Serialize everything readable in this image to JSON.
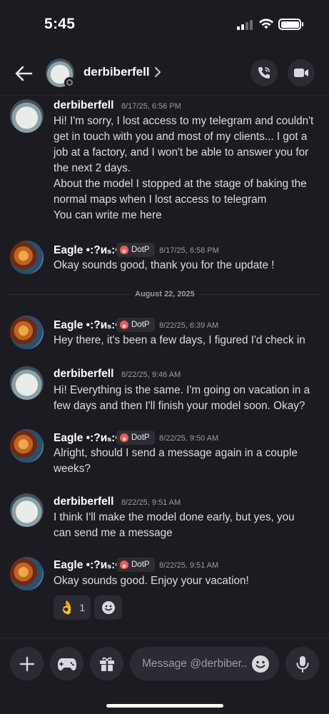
{
  "status_bar": {
    "time": "5:45"
  },
  "header": {
    "title": "derbiberfell"
  },
  "divider": {
    "label": "August 22, 2025"
  },
  "messages": [
    {
      "author": "derbiberfell",
      "timestamp": "8/17/25, 6:56 PM",
      "lines": [
        "Hi! I'm sorry, I lost access to my telegram and couldn't",
        "get in touch with you and most of my clients... I got a",
        "job at a factory, and I won't be able to answer you for",
        "the next 2 days.",
        "About the model I stopped at the stage of baking the",
        "normal maps when I lost access to telegram"
      ],
      "extra": "You can write me here"
    },
    {
      "author": "Eagle •:?ᴎₛ:•",
      "badge": "DotP",
      "timestamp": "8/17/25, 6:58 PM",
      "lines": [
        "Okay sounds good, thank you for the update !"
      ]
    },
    {
      "author": "Eagle •:?ᴎₛ:•",
      "badge": "DotP",
      "timestamp": "8/22/25, 6:39 AM",
      "lines": [
        "Hey there, it's been a few days, I figured I'd check in"
      ]
    },
    {
      "author": "derbiberfell",
      "timestamp": "8/22/25, 9:46 AM",
      "lines": [
        "Hi! Everything is the same. I'm going on vacation in a",
        "few days and then I'll finish your model soon. Okay?"
      ]
    },
    {
      "author": "Eagle •:?ᴎₛ:•",
      "badge": "DotP",
      "timestamp": "8/22/25, 9:50 AM",
      "lines": [
        "Alright, should I send a message again in a couple",
        "weeks?"
      ]
    },
    {
      "author": "derbiberfell",
      "timestamp": "8/22/25, 9:51 AM",
      "lines": [
        "I think I'll make the model done early, but yes, you",
        "can send me a message"
      ]
    },
    {
      "author": "Eagle •:?ᴎₛ:•",
      "badge": "DotP",
      "timestamp": "8/22/25, 9:51 AM",
      "lines": [
        "Okay sounds good. Enjoy your vacation!"
      ]
    }
  ],
  "reaction": {
    "emoji": "👌",
    "count": "1"
  },
  "input": {
    "placeholder": "Message @derbiber.."
  },
  "colors": {
    "background": "#1b1b21",
    "surface": "#2b2c33",
    "badge_flame": "#f0584a"
  }
}
